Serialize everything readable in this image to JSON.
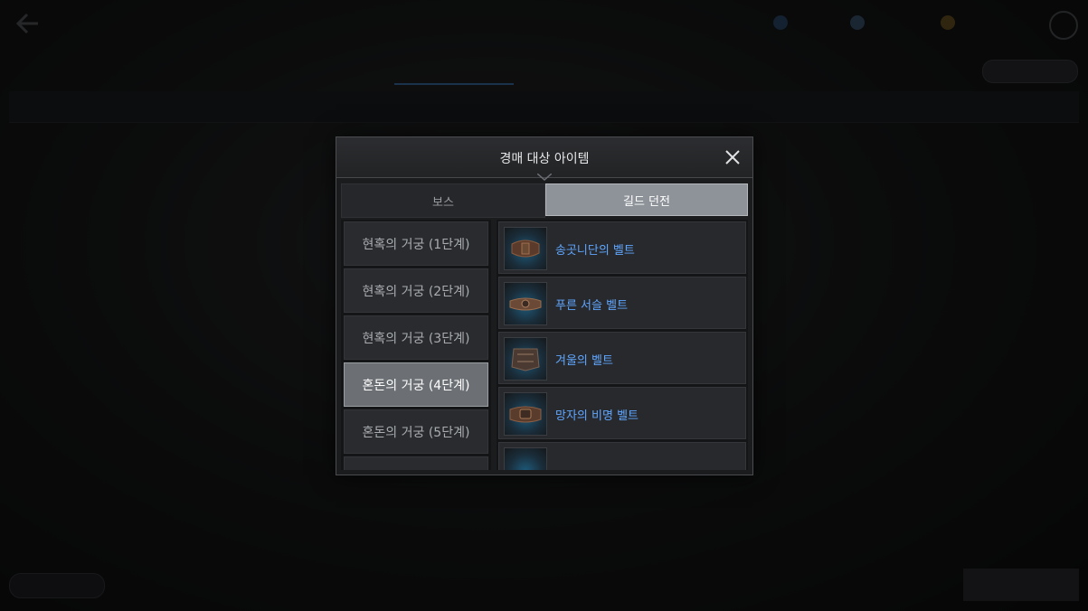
{
  "modal": {
    "title": "경매 대상 아이템",
    "tabs": [
      {
        "label": "보스",
        "selected": false
      },
      {
        "label": "길드 던전",
        "selected": true
      }
    ],
    "dungeons": [
      {
        "label": "현혹의 거궁 (1단계)",
        "selected": false
      },
      {
        "label": "현혹의 거궁 (2단계)",
        "selected": false
      },
      {
        "label": "현혹의 거궁 (3단계)",
        "selected": false
      },
      {
        "label": "혼돈의 거궁 (4단계)",
        "selected": true
      },
      {
        "label": "혼돈의 거궁 (5단계)",
        "selected": false
      }
    ],
    "items": [
      {
        "name": "송곳니단의 벨트",
        "icon": "belt-icon"
      },
      {
        "name": "푸른 서슬 벨트",
        "icon": "belt-icon"
      },
      {
        "name": "겨울의 벨트",
        "icon": "belt-icon"
      },
      {
        "name": "망자의 비명 벨트",
        "icon": "belt-icon"
      }
    ],
    "rarity_color": "#5fa6ff"
  }
}
